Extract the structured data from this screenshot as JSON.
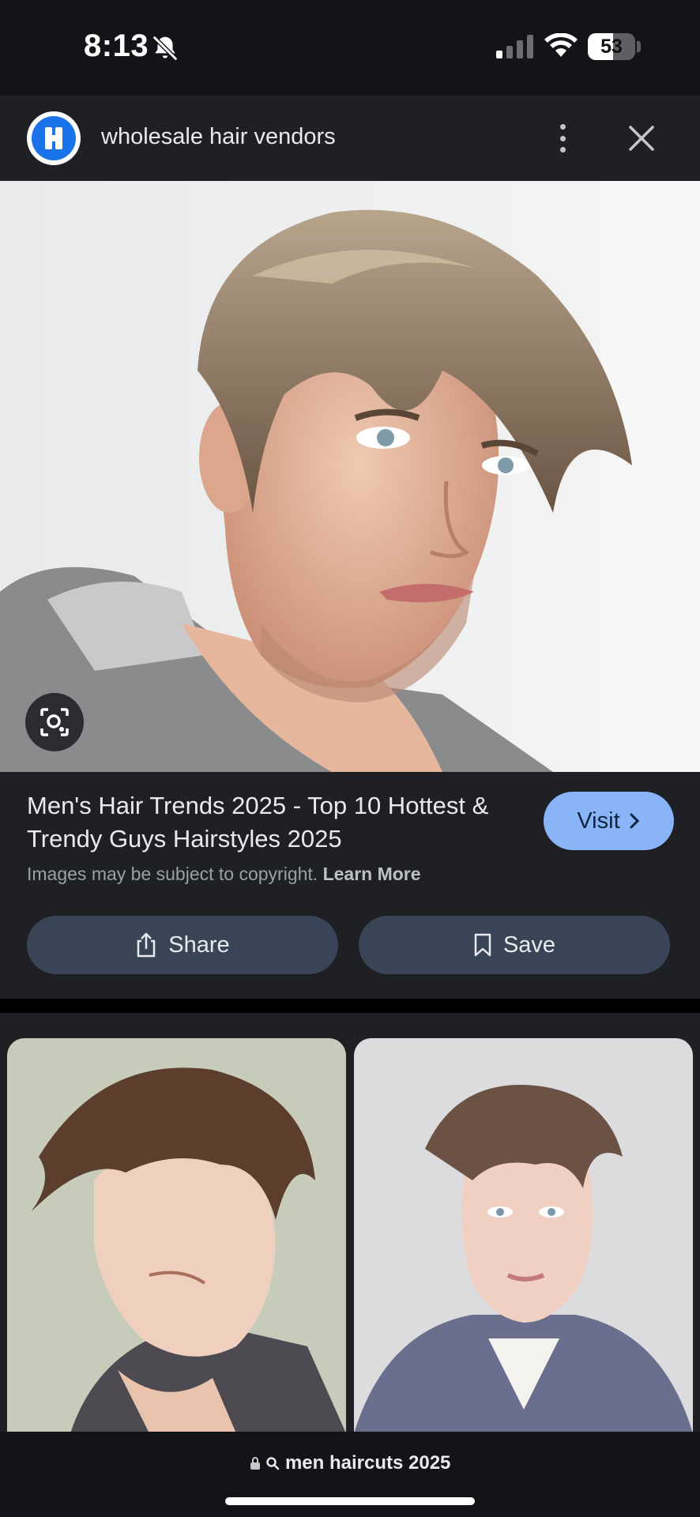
{
  "status_bar": {
    "time": "8:13",
    "battery": "53"
  },
  "header": {
    "title": "wholesale hair vendors"
  },
  "result": {
    "title": "Men's Hair Trends 2025 - Top 10 Hottest & Trendy Guys Hairstyles 2025",
    "visit_label": "Visit",
    "copyright_text": "Images may be subject to copyright.",
    "learn_more": "Learn More",
    "share_label": "Share",
    "save_label": "Save"
  },
  "bottom_bar": {
    "url": "men haircuts 2025"
  },
  "colors": {
    "accent": "#8ab4f8",
    "button_bg": "#394457",
    "background": "#1f2024"
  }
}
